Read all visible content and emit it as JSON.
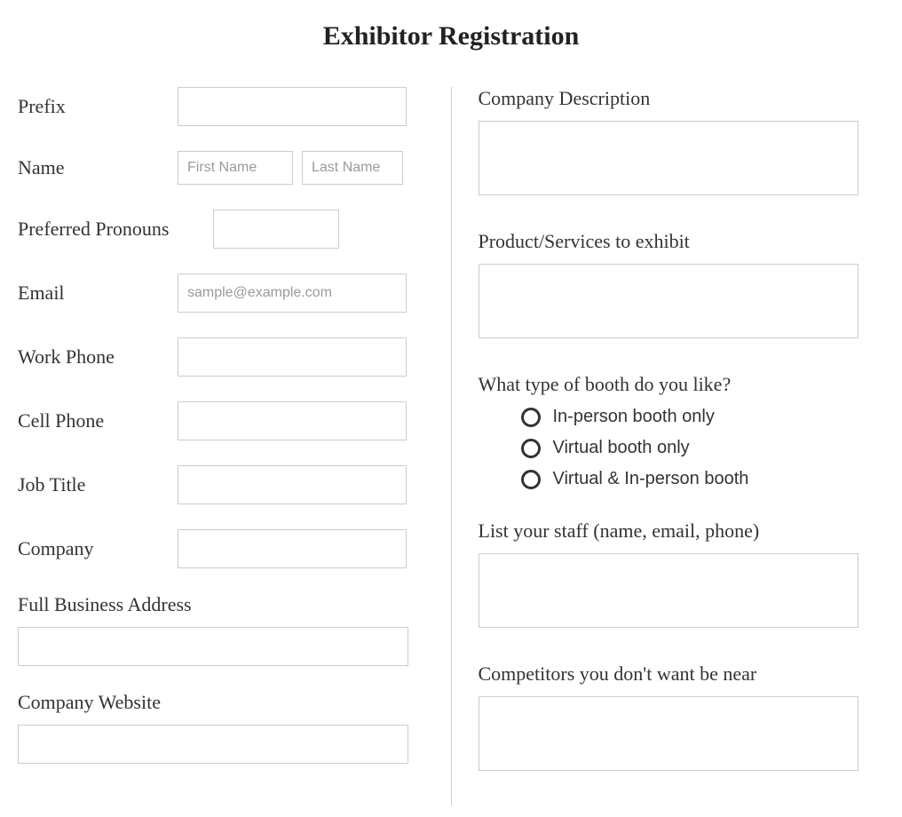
{
  "title": "Exhibitor Registration",
  "left": {
    "prefix_label": "Prefix",
    "name_label": "Name",
    "first_name_placeholder": "First Name",
    "last_name_placeholder": "Last Name",
    "pronouns_label": "Preferred Pronouns",
    "email_label": "Email",
    "email_placeholder": "sample@example.com",
    "work_phone_label": "Work Phone",
    "cell_phone_label": "Cell Phone",
    "job_title_label": "Job Title",
    "company_label": "Company",
    "full_address_label": "Full Business Address",
    "company_website_label": "Company Website"
  },
  "right": {
    "company_description_label": "Company Description",
    "products_label": "Product/Services to exhibit",
    "booth_type_label": "What type of booth do you like?",
    "booth_options": {
      "option1": "In-person booth only",
      "option2": "Virtual booth only",
      "option3": "Virtual & In-person booth"
    },
    "staff_label": "List your staff (name, email, phone)",
    "competitors_label": "Competitors you don't want be near"
  }
}
